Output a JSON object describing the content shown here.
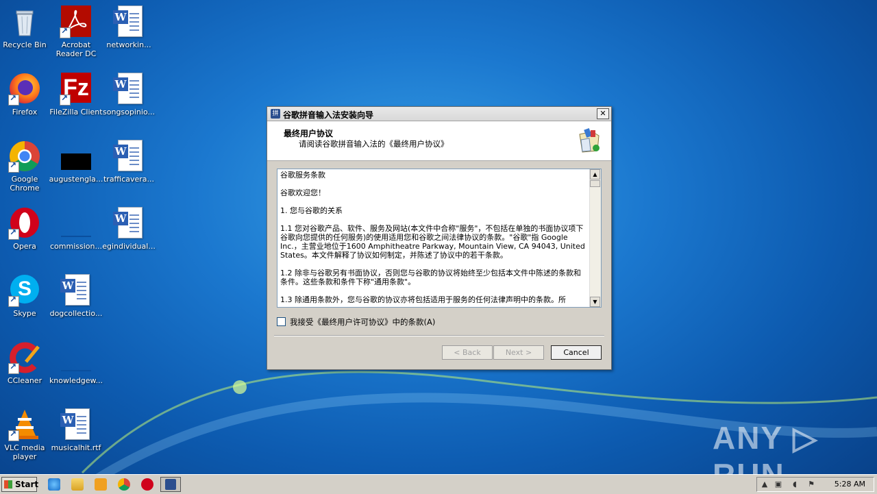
{
  "desktop": {
    "icons": [
      {
        "label": "Recycle Bin"
      },
      {
        "label": "Acrobat Reader DC"
      },
      {
        "label": "networkin..."
      },
      {
        "label": "Firefox"
      },
      {
        "label": "FileZilla Client"
      },
      {
        "label": "songsopinio..."
      },
      {
        "label": "Google Chrome"
      },
      {
        "label": "augustengla..."
      },
      {
        "label": "trafficavera..."
      },
      {
        "label": "Opera"
      },
      {
        "label": "commission..."
      },
      {
        "label": "egindividual..."
      },
      {
        "label": "Skype"
      },
      {
        "label": "dogcollectio..."
      },
      {
        "label": "CCleaner"
      },
      {
        "label": "knowledgew..."
      },
      {
        "label": "VLC media player"
      },
      {
        "label": "musicalhit.rtf"
      }
    ]
  },
  "watermark": "ANY ▷ RUN",
  "dialog": {
    "title": "谷歌拼音输入法安装向导",
    "close_label": "✕",
    "header_title": "最终用户协议",
    "header_subtitle": "请阅读谷歌拼音输入法的《最终用户协议》",
    "license_paragraphs": [
      "谷歌服务条款",
      "谷歌欢迎您！",
      "1. 您与谷歌的关系",
      "1.1 您对谷歌产品、软件、服务及网站(本文件中合称\"服务\"，不包括在单独的书面协议项下谷歌向您提供的任何服务)的使用适用您和谷歌之间法律协议的条款。\"谷歌\"指 Google Inc.，主营业地位于1600 Amphitheatre Parkway, Mountain View, CA 94043, United States。本文件解释了协议如何制定，并陈述了协议中的若干条款。",
      "1.2 除非与谷歌另有书面协议，否则您与谷歌的协议将始终至少包括本文件中陈述的条款和条件。这些条款和条件下称\"通用条款\"。",
      "1.3 除通用条款外，您与谷歌的协议亦将包括适用于服务的任何法律声明中的条款。所"
    ],
    "accept_label": "我接受《最终用户许可协议》中的条款(A)",
    "accept_checked": false,
    "buttons": {
      "back": "< Back",
      "next": "Next >",
      "cancel": "Cancel"
    }
  },
  "taskbar": {
    "start_label": "Start",
    "clock": "5:28 AM"
  }
}
